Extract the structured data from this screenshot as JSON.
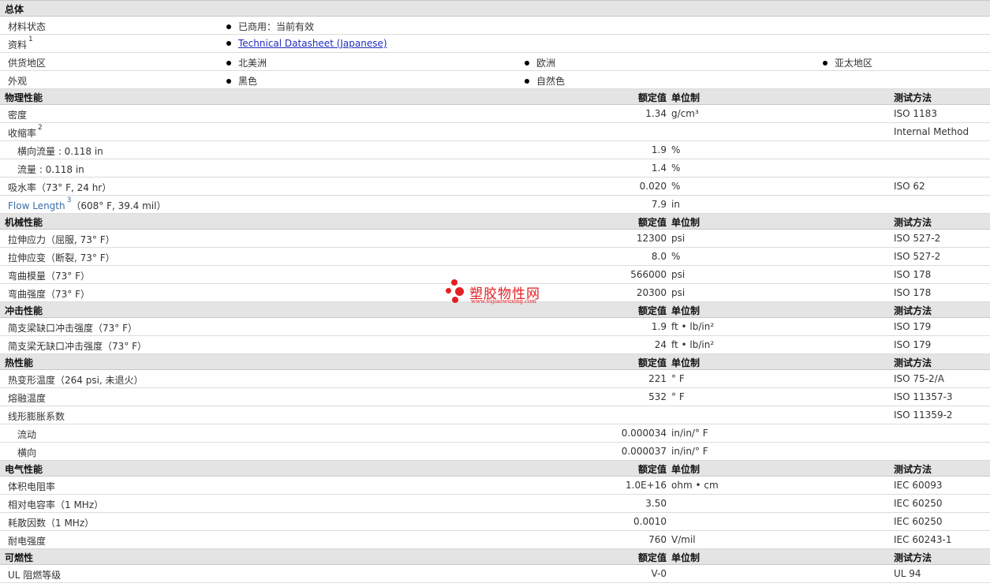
{
  "general": {
    "title": "总体",
    "status_label": "材料状态",
    "status_value": "已商用：当前有效",
    "docs_label": "资料",
    "docs_sup": "1",
    "docs_link": "Technical Datasheet (Japanese)",
    "regions_label": "供货地区",
    "regions": [
      "北美洲",
      "欧洲",
      "亚太地区"
    ],
    "appearance_label": "外观",
    "appearance": [
      "黑色",
      "自然色"
    ]
  },
  "headers": {
    "value": "额定值",
    "unit": "单位制",
    "method": "测试方法"
  },
  "physical": {
    "title": "物理性能",
    "rows": [
      {
        "name": "密度",
        "value": "1.34",
        "unit": "g/cm³",
        "method": "ISO 1183"
      },
      {
        "name": "收缩率",
        "sup": "2",
        "value": "",
        "unit": "",
        "method": "Internal Method"
      },
      {
        "name": "横向流量 : 0.118 in",
        "value": "1.9",
        "unit": "%",
        "method": ""
      },
      {
        "name": "流量 : 0.118 in",
        "value": "1.4",
        "unit": "%",
        "method": ""
      },
      {
        "name": "吸水率（73° F, 24 hr）",
        "value": "0.020",
        "unit": "%",
        "method": "ISO 62"
      },
      {
        "name": "Flow Length",
        "sup": "3",
        "cond": "（608° F, 39.4 mil）",
        "value": "7.9",
        "unit": "in",
        "method": ""
      }
    ]
  },
  "mechanical": {
    "title": "机械性能",
    "rows": [
      {
        "name": "拉伸应力（屈服, 73° F）",
        "value": "12300",
        "unit": "psi",
        "method": "ISO 527-2"
      },
      {
        "name": "拉伸应变（断裂, 73° F）",
        "value": "8.0",
        "unit": "%",
        "method": "ISO 527-2"
      },
      {
        "name": "弯曲模量（73° F）",
        "value": "566000",
        "unit": "psi",
        "method": "ISO 178"
      },
      {
        "name": "弯曲强度（73° F）",
        "value": "20300",
        "unit": "psi",
        "method": "ISO 178"
      }
    ]
  },
  "impact": {
    "title": "冲击性能",
    "rows": [
      {
        "name": "简支梁缺口冲击强度（73° F）",
        "value": "1.9",
        "unit": "ft • lb/in²",
        "method": "ISO 179"
      },
      {
        "name": "简支梁无缺口冲击强度（73° F）",
        "value": "24",
        "unit": "ft • lb/in²",
        "method": "ISO 179"
      }
    ]
  },
  "thermal": {
    "title": "热性能",
    "rows": [
      {
        "name": "热变形温度（264 psi, 未退火）",
        "value": "221",
        "unit": "° F",
        "method": "ISO 75-2/A"
      },
      {
        "name": "熔融温度",
        "value": "532",
        "unit": "° F",
        "method": "ISO 11357-3"
      },
      {
        "name": "线形膨胀系数",
        "value": "",
        "unit": "",
        "method": "ISO 11359-2"
      },
      {
        "name": "流动",
        "value": "0.000034",
        "unit": "in/in/° F",
        "method": ""
      },
      {
        "name": "横向",
        "value": "0.000037",
        "unit": "in/in/° F",
        "method": ""
      }
    ]
  },
  "electrical": {
    "title": "电气性能",
    "rows": [
      {
        "name": "体积电阻率",
        "value": "1.0E+16",
        "unit": "ohm • cm",
        "method": "IEC 60093"
      },
      {
        "name": "相对电容率（1 MHz）",
        "value": "3.50",
        "unit": "",
        "method": "IEC 60250"
      },
      {
        "name": "耗散因数（1 MHz）",
        "value": "0.0010",
        "unit": "",
        "method": "IEC 60250"
      },
      {
        "name": "耐电强度",
        "value": "760",
        "unit": "V/mil",
        "method": "IEC 60243-1"
      }
    ]
  },
  "flammability": {
    "title": "可燃性",
    "rows": [
      {
        "name": "UL 阻燃等级",
        "value": "V-0",
        "unit": "",
        "method": "UL 94"
      }
    ]
  },
  "watermark": {
    "name": "塑胶物性网",
    "url": "www.sujiaowuxing.com"
  }
}
